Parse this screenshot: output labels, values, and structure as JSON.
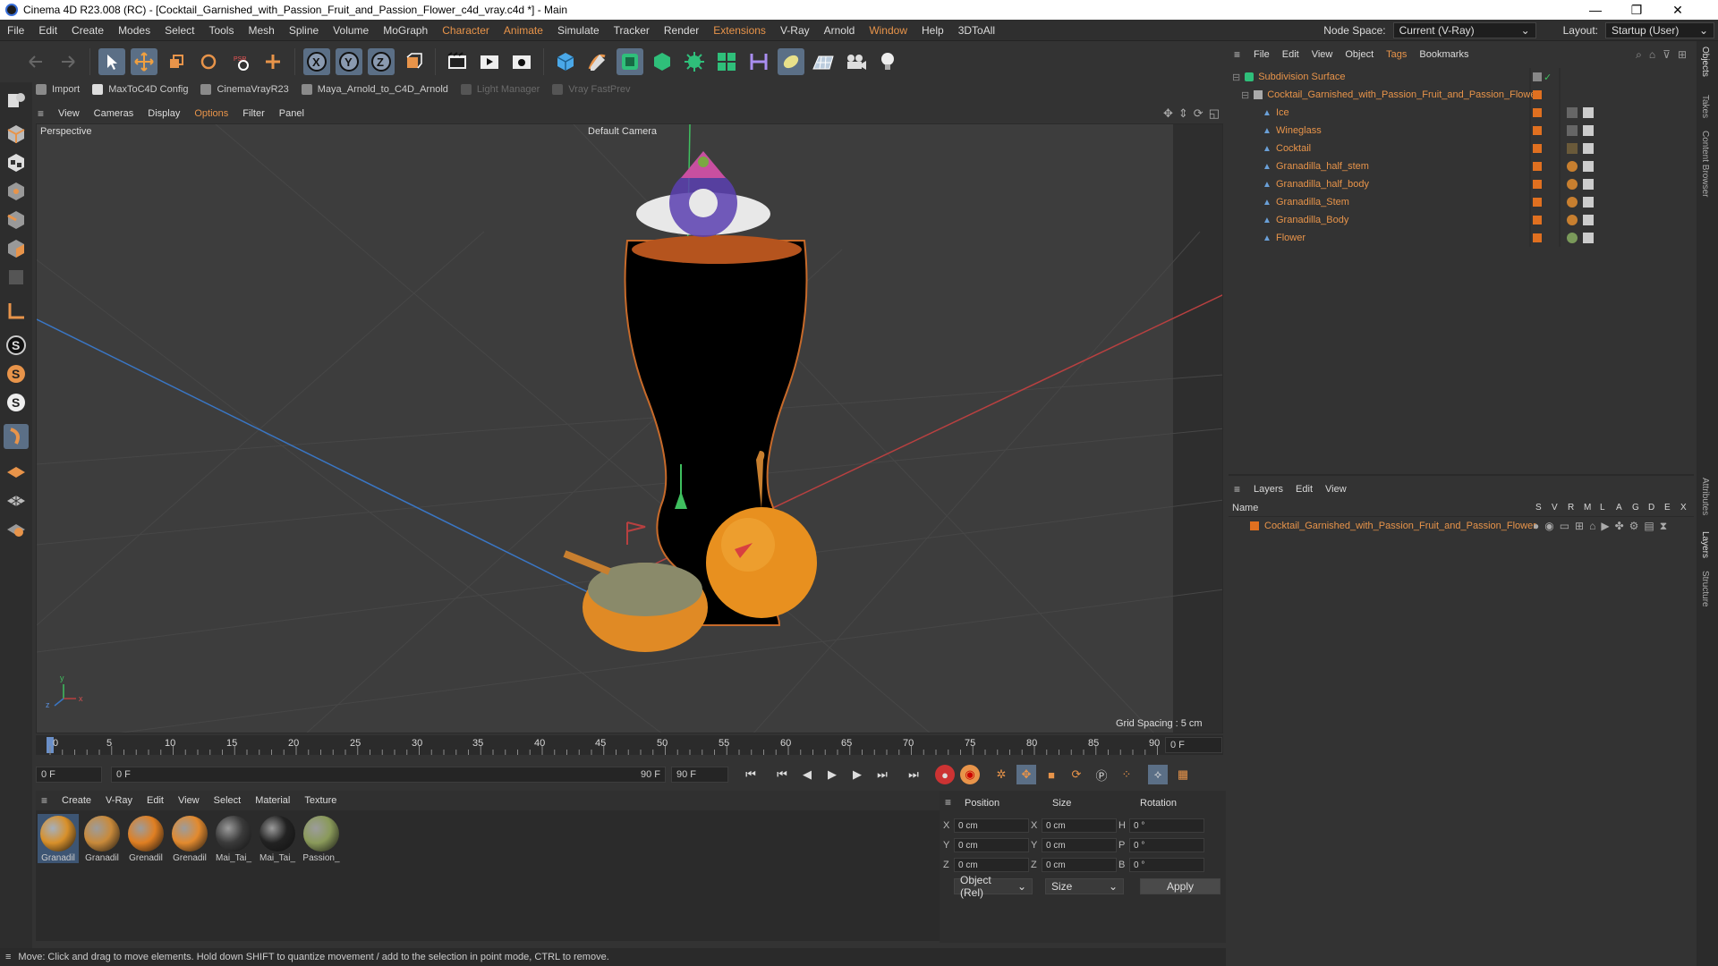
{
  "window": {
    "title": "Cinema 4D R23.008 (RC) - [Cocktail_Garnished_with_Passion_Fruit_and_Passion_Flower_c4d_vray.c4d *] - Main"
  },
  "menubar": {
    "items": [
      "File",
      "Edit",
      "Create",
      "Modes",
      "Select",
      "Tools",
      "Mesh",
      "Spline",
      "Volume",
      "MoGraph",
      "Character",
      "Animate",
      "Simulate",
      "Tracker",
      "Render",
      "Extensions",
      "V-Ray",
      "Arnold",
      "Window",
      "Help",
      "3DToAll"
    ],
    "node_space_label": "Node Space:",
    "node_space_value": "Current (V-Ray)",
    "layout_label": "Layout:",
    "layout_value": "Startup (User)"
  },
  "pluginbar": {
    "items": [
      "Import",
      "MaxToC4D Config",
      "CinemaVrayR23",
      "Maya_Arnold_to_C4D_Arnold",
      "Light Manager",
      "Vray FastPrev"
    ]
  },
  "viewport": {
    "menu": [
      "View",
      "Cameras",
      "Display",
      "Options",
      "Filter",
      "Panel"
    ],
    "label": "Perspective",
    "camera": "Default Camera",
    "grid_spacing": "Grid Spacing : 5 cm"
  },
  "timeline": {
    "ticks": [
      "0",
      "5",
      "10",
      "15",
      "20",
      "25",
      "30",
      "35",
      "40",
      "45",
      "50",
      "55",
      "60",
      "65",
      "70",
      "75",
      "80",
      "85",
      "90"
    ],
    "end_field": "0 F",
    "start_frame": "0 F",
    "current_frame": "0 F",
    "range_end": "90 F",
    "end_frame": "90 F"
  },
  "material": {
    "menu": [
      "Create",
      "V-Ray",
      "Edit",
      "View",
      "Select",
      "Material",
      "Texture"
    ],
    "items": [
      {
        "label": "Granadil",
        "color": "#d8902a"
      },
      {
        "label": "Granadil",
        "color": "#c98a3a"
      },
      {
        "label": "Grenadil",
        "color": "#e07f22"
      },
      {
        "label": "Grenadil",
        "color": "#e38a2e"
      },
      {
        "label": "Mai_Tai_",
        "color": "#3a3a3a"
      },
      {
        "label": "Mai_Tai_",
        "color": "#222222"
      },
      {
        "label": "Passion_",
        "color": "#8a9a5a"
      }
    ]
  },
  "coords": {
    "headers": [
      "Position",
      "Size",
      "Rotation"
    ],
    "rows": [
      {
        "a": "X",
        "av": "0 cm",
        "b": "X",
        "bv": "0 cm",
        "c": "H",
        "cv": "0 °"
      },
      {
        "a": "Y",
        "av": "0 cm",
        "b": "Y",
        "bv": "0 cm",
        "c": "P",
        "cv": "0 °"
      },
      {
        "a": "Z",
        "av": "0 cm",
        "b": "Z",
        "bv": "0 cm",
        "c": "B",
        "cv": "0 °"
      }
    ],
    "mode": "Object (Rel)",
    "size_mode": "Size",
    "apply": "Apply"
  },
  "status": {
    "text": "Move: Click and drag to move elements. Hold down SHIFT to quantize movement / add to the selection in point mode, CTRL to remove."
  },
  "objects": {
    "menu": [
      "File",
      "Edit",
      "View",
      "Object",
      "Tags",
      "Bookmarks"
    ],
    "root": "Subdivision Surface",
    "group": "Cocktail_Garnished_with_Passion_Fruit_and_Passion_Flower",
    "children": [
      "Ice",
      "Wineglass",
      "Cocktail",
      "Granadilla_half_stem",
      "Granadilla_half_body",
      "Granadilla_Stem",
      "Granadilla_Body",
      "Flower"
    ]
  },
  "layers": {
    "menu": [
      "Layers",
      "Edit",
      "View"
    ],
    "name_header": "Name",
    "flags": [
      "S",
      "V",
      "R",
      "M",
      "L",
      "A",
      "G",
      "D",
      "E",
      "X"
    ],
    "row": "Cocktail_Garnished_with_Passion_Fruit_and_Passion_Flower"
  },
  "side_tabs": [
    "Objects",
    "Takes",
    "Content Browser",
    "Attributes",
    "Layers",
    "Structure"
  ],
  "colors": {
    "accent": "#e8944a",
    "panel": "#333333",
    "viewport": "#3c3c3c"
  }
}
